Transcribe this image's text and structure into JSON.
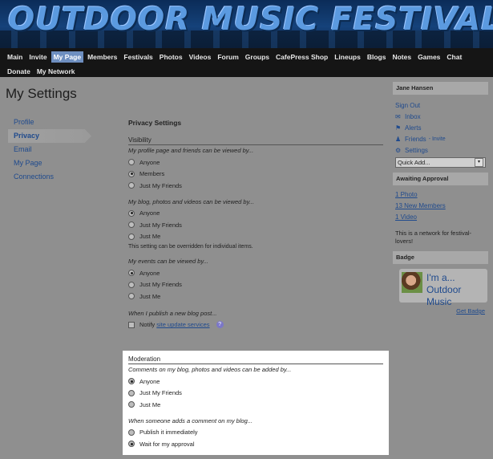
{
  "banner": {
    "title": "OUTDOOR MUSIC FESTIVALS"
  },
  "nav": {
    "row1": [
      "Main",
      "Invite",
      "My Page",
      "Members",
      "Festivals",
      "Photos",
      "Videos",
      "Forum",
      "Groups",
      "CafePress Shop",
      "Lineups",
      "Blogs",
      "Notes",
      "Games",
      "Chat"
    ],
    "row2": [
      "Donate",
      "My Network"
    ],
    "active": "My Page"
  },
  "page_title": "My Settings",
  "left_menu": [
    "Profile",
    "Privacy",
    "Email",
    "My Page",
    "Connections"
  ],
  "privacy": {
    "section_title": "Privacy Settings",
    "visibility_head": "Visibility",
    "q_profile": "My profile page and friends can be viewed by...",
    "profile_opts": [
      "Anyone",
      "Members",
      "Just My Friends"
    ],
    "q_blog": "My blog, photos and videos can be viewed by...",
    "blog_opts": [
      "Anyone",
      "Just My Friends",
      "Just Me"
    ],
    "blog_note": "This setting can be overridden for individual items.",
    "q_events": "My events can be viewed by...",
    "events_opts": [
      "Anyone",
      "Just My Friends",
      "Just Me"
    ],
    "q_publish": "When I publish a new blog post...",
    "notify_prefix": "Notify",
    "notify_link": "site update services",
    "help": "?"
  },
  "moderation": {
    "head": "Moderation",
    "q_comments": "Comments on my blog, photos and videos can be added by...",
    "comment_opts": [
      "Anyone",
      "Just My Friends",
      "Just Me"
    ],
    "q_add": "When someone adds a comment on my blog...",
    "add_opts": [
      "Publish it immediately",
      "Wait for my approval"
    ]
  },
  "sidebar": {
    "user_name": "Jane Hansen",
    "sign_out": "Sign Out",
    "inbox": "Inbox",
    "alerts": "Alerts",
    "friends": "Friends",
    "friends_sub": "- Invite",
    "settings": "Settings",
    "quick_add": "Quick Add...",
    "awaiting_head": "Awaiting Approval",
    "awaiting": [
      "1 Photo",
      "13 New Members",
      "1 Video"
    ],
    "network_text": "This is a network for festival-lovers!",
    "badge_head": "Badge",
    "badge_line1": "I'm a...",
    "badge_line2": "Outdoor",
    "badge_line3": "Music",
    "get_badge": "Get Badge"
  }
}
